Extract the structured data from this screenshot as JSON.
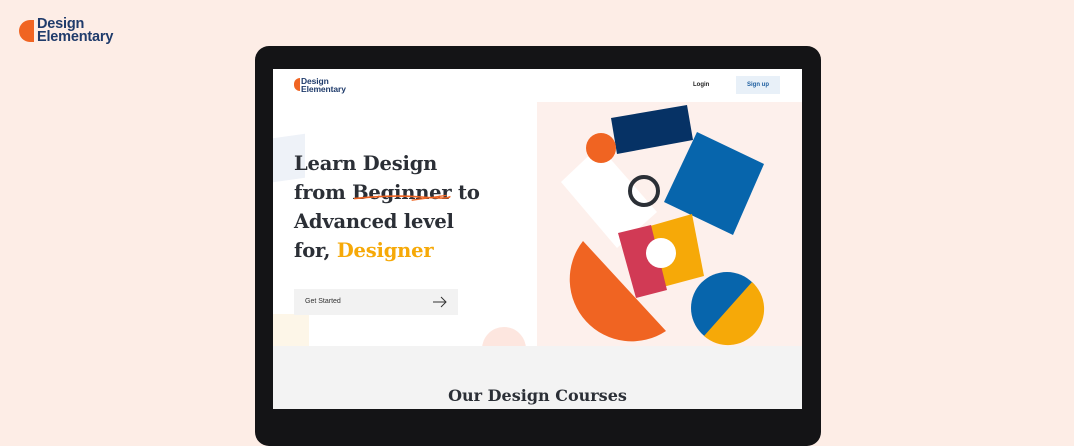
{
  "brand": {
    "line1": "Design",
    "line2": "Elementary"
  },
  "site": {
    "logo": {
      "line1": "Design",
      "line2": "Elementary"
    },
    "nav": {
      "login": "Login",
      "signup": "Sign up"
    },
    "hero": {
      "line1": "Learn Design",
      "line2_prefix": "from ",
      "line2_underlined": "Beginner",
      "line2_suffix": " to",
      "line3": "Advanced level",
      "line4_prefix": "for, ",
      "line4_accent": "Designer",
      "cta_label": "Get Started"
    },
    "courses": {
      "title": "Our Design Courses"
    }
  },
  "colors": {
    "orange": "#f06422",
    "navy": "#063265",
    "blue": "#0765ac",
    "yellow": "#f6a908",
    "red": "#d13a55",
    "dark": "#2b2f36"
  },
  "icons": [
    "arrow-right-icon",
    "logo-mark-icon"
  ]
}
